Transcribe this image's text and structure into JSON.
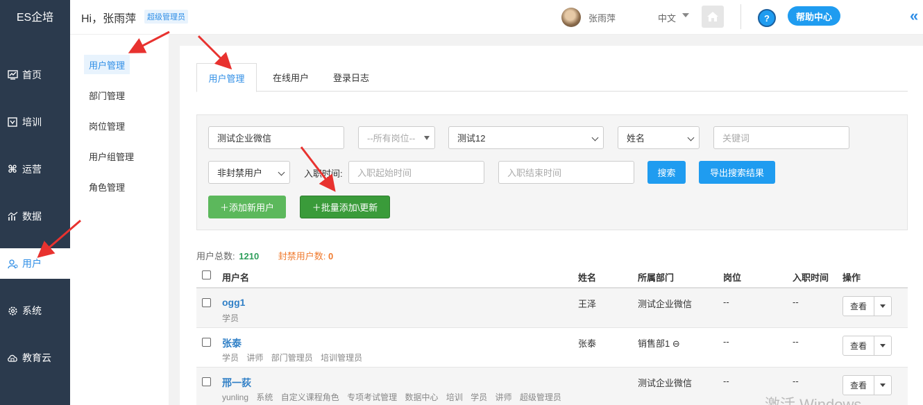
{
  "brand": "ES企培",
  "nav": [
    {
      "label": "首页",
      "icon": "dashboard-icon"
    },
    {
      "label": "培训",
      "icon": "training-icon"
    },
    {
      "label": "运营",
      "icon": "command-icon"
    },
    {
      "label": "数据",
      "icon": "chart-icon"
    },
    {
      "label": "用户",
      "icon": "user-icon"
    },
    {
      "label": "系统",
      "icon": "gear-icon"
    },
    {
      "label": "教育云",
      "icon": "cloud-icon"
    }
  ],
  "header": {
    "greeting": "Hi，张雨萍",
    "role_badge": "超级管理员",
    "user_name": "张雨萍",
    "language": "中文",
    "help_label": "帮助中心",
    "help_icon_text": "?"
  },
  "subnav": [
    "用户管理",
    "部门管理",
    "岗位管理",
    "用户组管理",
    "角色管理"
  ],
  "tabs": [
    "用户管理",
    "在线用户",
    "登录日志"
  ],
  "filters": {
    "org_value": "测试企业微信",
    "post_select": "--所有岗位--",
    "dept_select": "测试12",
    "field_select": "姓名",
    "keyword_placeholder": "关键词",
    "status_select": "非封禁用户",
    "hire_label": "入职时间:",
    "start_placeholder": "入职起始时间",
    "end_placeholder": "入职结束时间",
    "search_button": "搜索",
    "export_button": "导出搜索结果",
    "add_button": "＋添加新用户",
    "batch_button": "＋批量添加\\更新"
  },
  "stats": {
    "total_label": "用户总数:",
    "total_value": "1210",
    "banned_label": "封禁用户数:",
    "banned_value": "0"
  },
  "table": {
    "headers": [
      "用户名",
      "姓名",
      "所属部门",
      "岗位",
      "入职时间",
      "操作"
    ],
    "rows": [
      {
        "username": "ogg1",
        "tags": [
          "学员"
        ],
        "name": "王泽",
        "dept": "测试企业微信",
        "post": "--",
        "hire": "--",
        "view": "查看"
      },
      {
        "username": "张泰",
        "tags": [
          "学员",
          "讲师",
          "部门管理员",
          "培训管理员"
        ],
        "name": "张泰",
        "dept": "销售部1 ⊖",
        "post": "--",
        "hire": "--",
        "view": "查看"
      },
      {
        "username": "邢一荻",
        "tags": [
          "yunling",
          "系统",
          "自定义课程角色",
          "专项考试管理",
          "数据中心",
          "培训",
          "学员",
          "讲师",
          "超级管理员"
        ],
        "name": "",
        "dept": "测试企业微信",
        "post": "--",
        "hire": "--",
        "view": "查看"
      }
    ]
  },
  "watermark": "激活 Windows",
  "colors": {
    "sidebar": "#2b3a4d",
    "accent": "#2f8ee6",
    "button_blue": "#1f9cf0",
    "button_green_light": "#5cb85c",
    "button_green_dark": "#3a9b3a",
    "arrow": "#e8322f"
  }
}
